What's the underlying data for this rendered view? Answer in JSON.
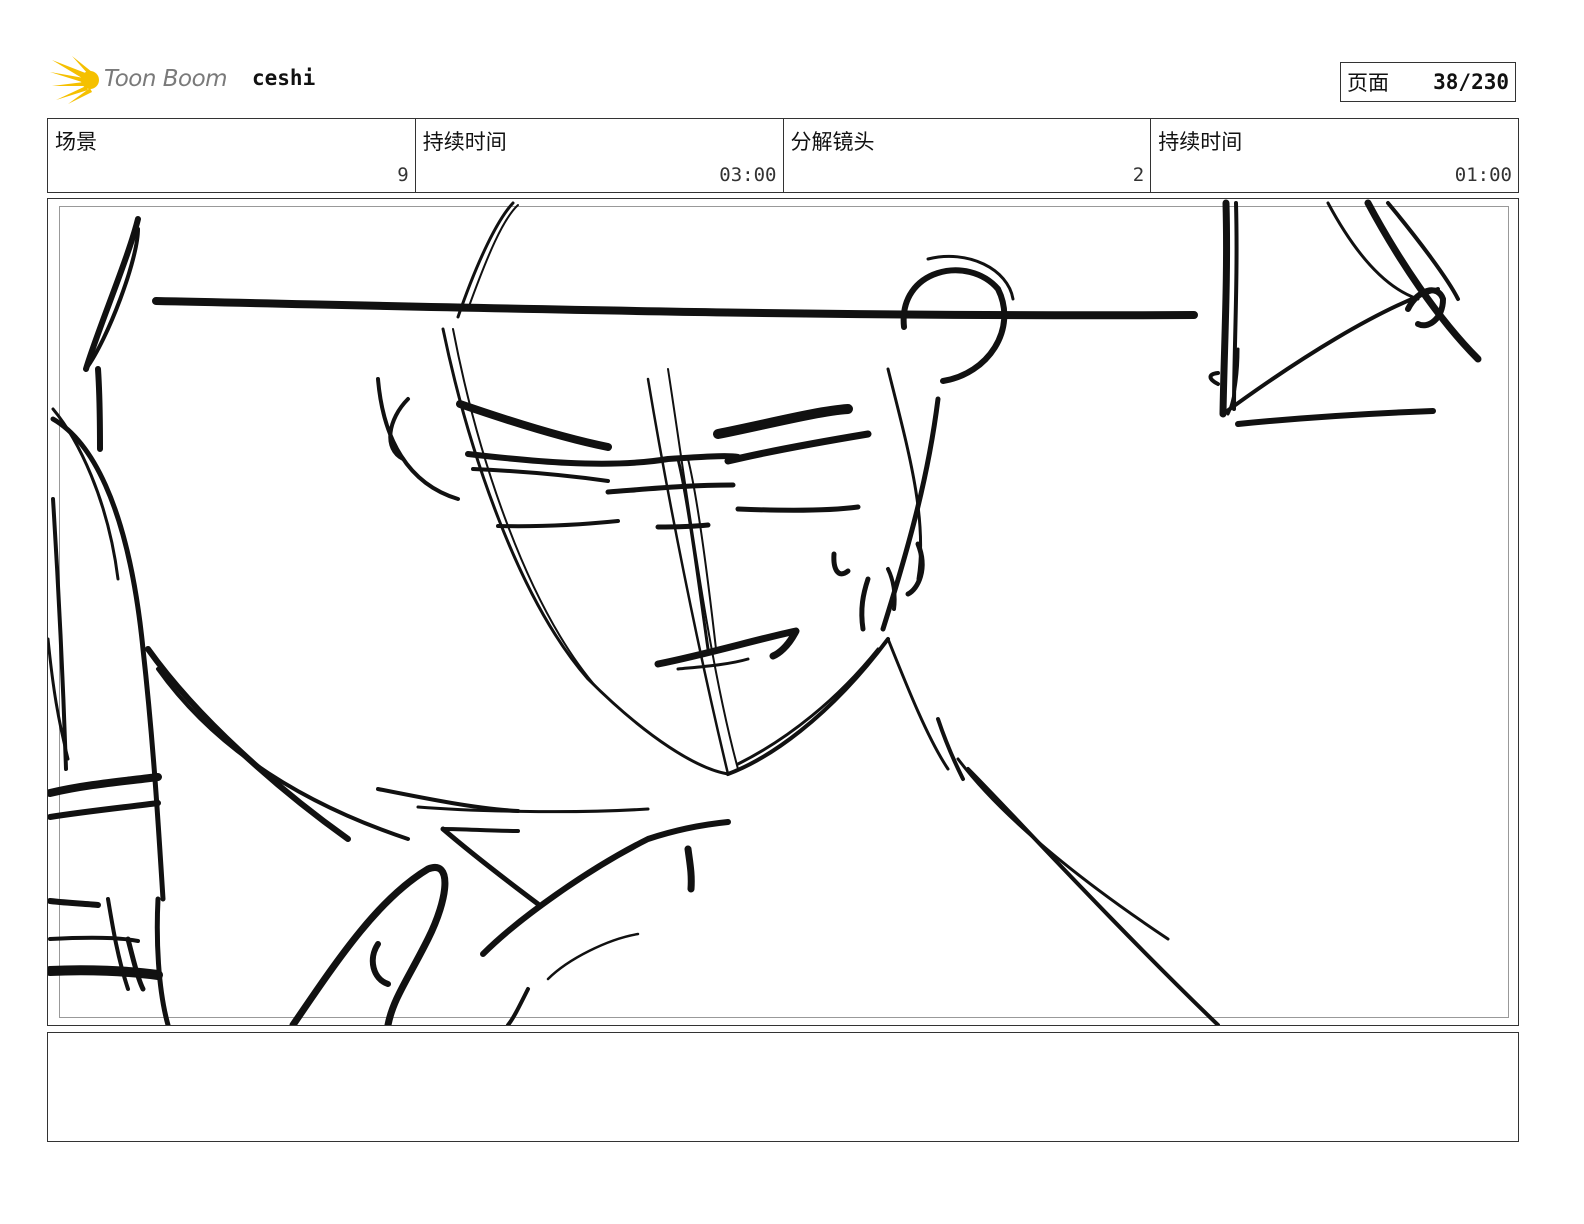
{
  "header": {
    "logo_text": "Toon Boom",
    "project_name": "ceshi",
    "page_label": "页面",
    "page_number": "38/230"
  },
  "info": {
    "scene_label": "场景",
    "scene_value": "9",
    "duration_label": "持续时间",
    "duration_value": "03:00",
    "panel_label": "分解镜头",
    "panel_value": "2",
    "panel_duration_label": "持续时间",
    "panel_duration_value": "01:00"
  },
  "icons": {
    "logo": "toon-boom-sun-icon"
  },
  "colors": {
    "logo_yellow": "#f5c000",
    "sketch": "#111111"
  },
  "notes": {
    "text": ""
  }
}
